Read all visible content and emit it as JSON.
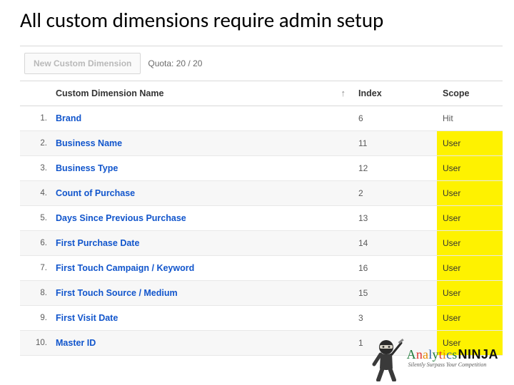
{
  "title": "All custom dimensions require admin setup",
  "toolbar": {
    "new_button_label": "New Custom Dimension",
    "quota_label": "Quota: 20 / 20"
  },
  "table": {
    "headers": {
      "name": "Custom Dimension Name",
      "index": "Index",
      "scope": "Scope"
    },
    "sort_arrow": "↑",
    "rows": [
      {
        "n": "1.",
        "name": "Brand",
        "index": "6",
        "scope": "Hit",
        "hl": false
      },
      {
        "n": "2.",
        "name": "Business Name",
        "index": "11",
        "scope": "User",
        "hl": true
      },
      {
        "n": "3.",
        "name": "Business Type",
        "index": "12",
        "scope": "User",
        "hl": true
      },
      {
        "n": "4.",
        "name": "Count of Purchase",
        "index": "2",
        "scope": "User",
        "hl": true
      },
      {
        "n": "5.",
        "name": "Days Since Previous Purchase",
        "index": "13",
        "scope": "User",
        "hl": true
      },
      {
        "n": "6.",
        "name": "First Purchase Date",
        "index": "14",
        "scope": "User",
        "hl": true
      },
      {
        "n": "7.",
        "name": "First Touch Campaign / Keyword",
        "index": "16",
        "scope": "User",
        "hl": true
      },
      {
        "n": "8.",
        "name": "First Touch Source / Medium",
        "index": "15",
        "scope": "User",
        "hl": true
      },
      {
        "n": "9.",
        "name": "First Visit Date",
        "index": "3",
        "scope": "User",
        "hl": true
      },
      {
        "n": "10.",
        "name": "Master ID",
        "index": "1",
        "scope": "User",
        "hl": true
      }
    ]
  },
  "brand": {
    "word1_letters": [
      "A",
      "n",
      "a",
      "l",
      "y",
      "t",
      "i",
      "c",
      "s"
    ],
    "word2": "NINJA",
    "tagline": "Silently Surpass Your Competition"
  }
}
